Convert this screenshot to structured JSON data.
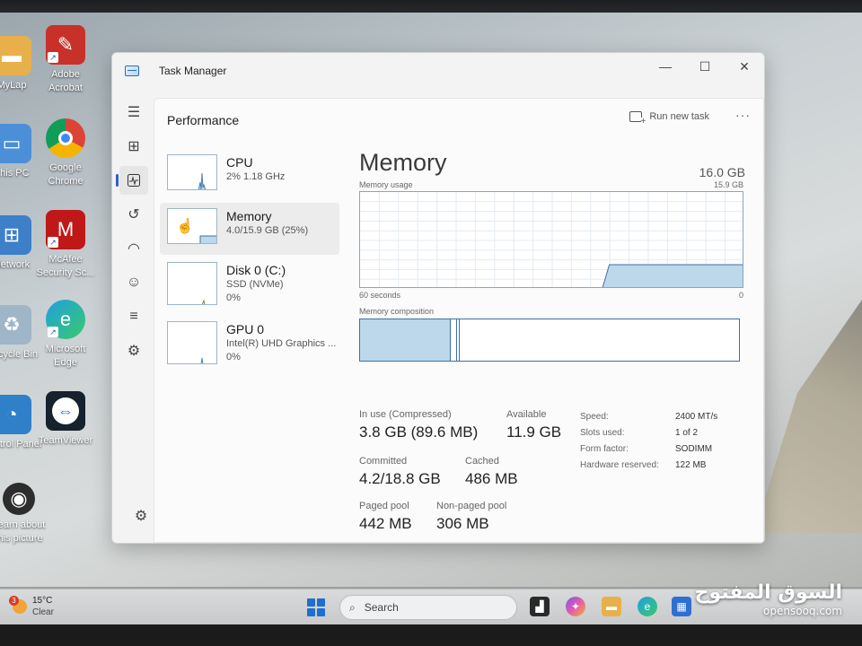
{
  "desktop": {
    "icons": [
      {
        "label_1": "MyLap",
        "label_2": ""
      },
      {
        "label_1": "Adobe",
        "label_2": "Acrobat"
      },
      {
        "label_1": "This PC",
        "label_2": ""
      },
      {
        "label_1": "Google",
        "label_2": "Chrome"
      },
      {
        "label_1": "Network",
        "label_2": ""
      },
      {
        "label_1": "McAfee",
        "label_2": "Security Sc..."
      },
      {
        "label_1": "Recycle Bin",
        "label_2": ""
      },
      {
        "label_1": "Microsoft",
        "label_2": "Edge"
      },
      {
        "label_1": "Control Panel",
        "label_2": ""
      },
      {
        "label_1": "TeamViewer",
        "label_2": ""
      },
      {
        "label_1": "Learn about",
        "label_2": "this picture"
      }
    ]
  },
  "window": {
    "title": "Task Manager",
    "minimize": "—",
    "maximize": "☐",
    "close": "✕"
  },
  "nav": {
    "items": [
      "hamburger-icon",
      "processes-icon",
      "performance-icon",
      "app-history-icon",
      "startup-apps-icon",
      "users-icon",
      "details-icon",
      "services-icon"
    ],
    "active": "performance-icon",
    "settings": "gear-icon"
  },
  "header": {
    "title": "Performance",
    "run_new_task": "Run new task",
    "more": "···"
  },
  "devices": [
    {
      "name": "CPU",
      "line1": "2%  1.18 GHz",
      "line2": ""
    },
    {
      "name": "Memory",
      "line1": "4.0/15.9 GB (25%)",
      "line2": ""
    },
    {
      "name": "Disk 0 (C:)",
      "line1": "SSD (NVMe)",
      "line2": "0%"
    },
    {
      "name": "GPU 0",
      "line1": "Intel(R) UHD Graphics ...",
      "line2": "0%"
    }
  ],
  "memory": {
    "title": "Memory",
    "total": "16.0 GB",
    "usage_label": "Memory usage",
    "usage_max": "15.9 GB",
    "axis_left": "60 seconds",
    "axis_right": "0",
    "composition_label": "Memory composition",
    "usage_fraction": 0.25,
    "composition": {
      "in_use": 0.24,
      "modified": 0.015,
      "standby": 0.008
    },
    "stats": {
      "in_use_label": "In use (Compressed)",
      "in_use_value": "3.8 GB (89.6 MB)",
      "available_label": "Available",
      "available_value": "11.9 GB",
      "committed_label": "Committed",
      "committed_value": "4.2/18.8 GB",
      "cached_label": "Cached",
      "cached_value": "486 MB",
      "paged_label": "Paged pool",
      "paged_value": "442 MB",
      "nonpaged_label": "Non-paged pool",
      "nonpaged_value": "306 MB"
    },
    "specs": [
      {
        "k": "Speed:",
        "v": "2400 MT/s"
      },
      {
        "k": "Slots used:",
        "v": "1 of 2"
      },
      {
        "k": "Form factor:",
        "v": "SODIMM"
      },
      {
        "k": "Hardware reserved:",
        "v": "122 MB"
      }
    ]
  },
  "taskbar": {
    "weather_badge": "3",
    "temperature": "15°C",
    "condition": "Clear",
    "search_placeholder": "Search"
  },
  "watermark": {
    "arabic": "السوق المفتوح",
    "english": "opensooq.com"
  },
  "colors": {
    "accent": "#2e62c4",
    "memory_graph": "#8aa4c2",
    "memory_fill": "#bcd8ea"
  }
}
